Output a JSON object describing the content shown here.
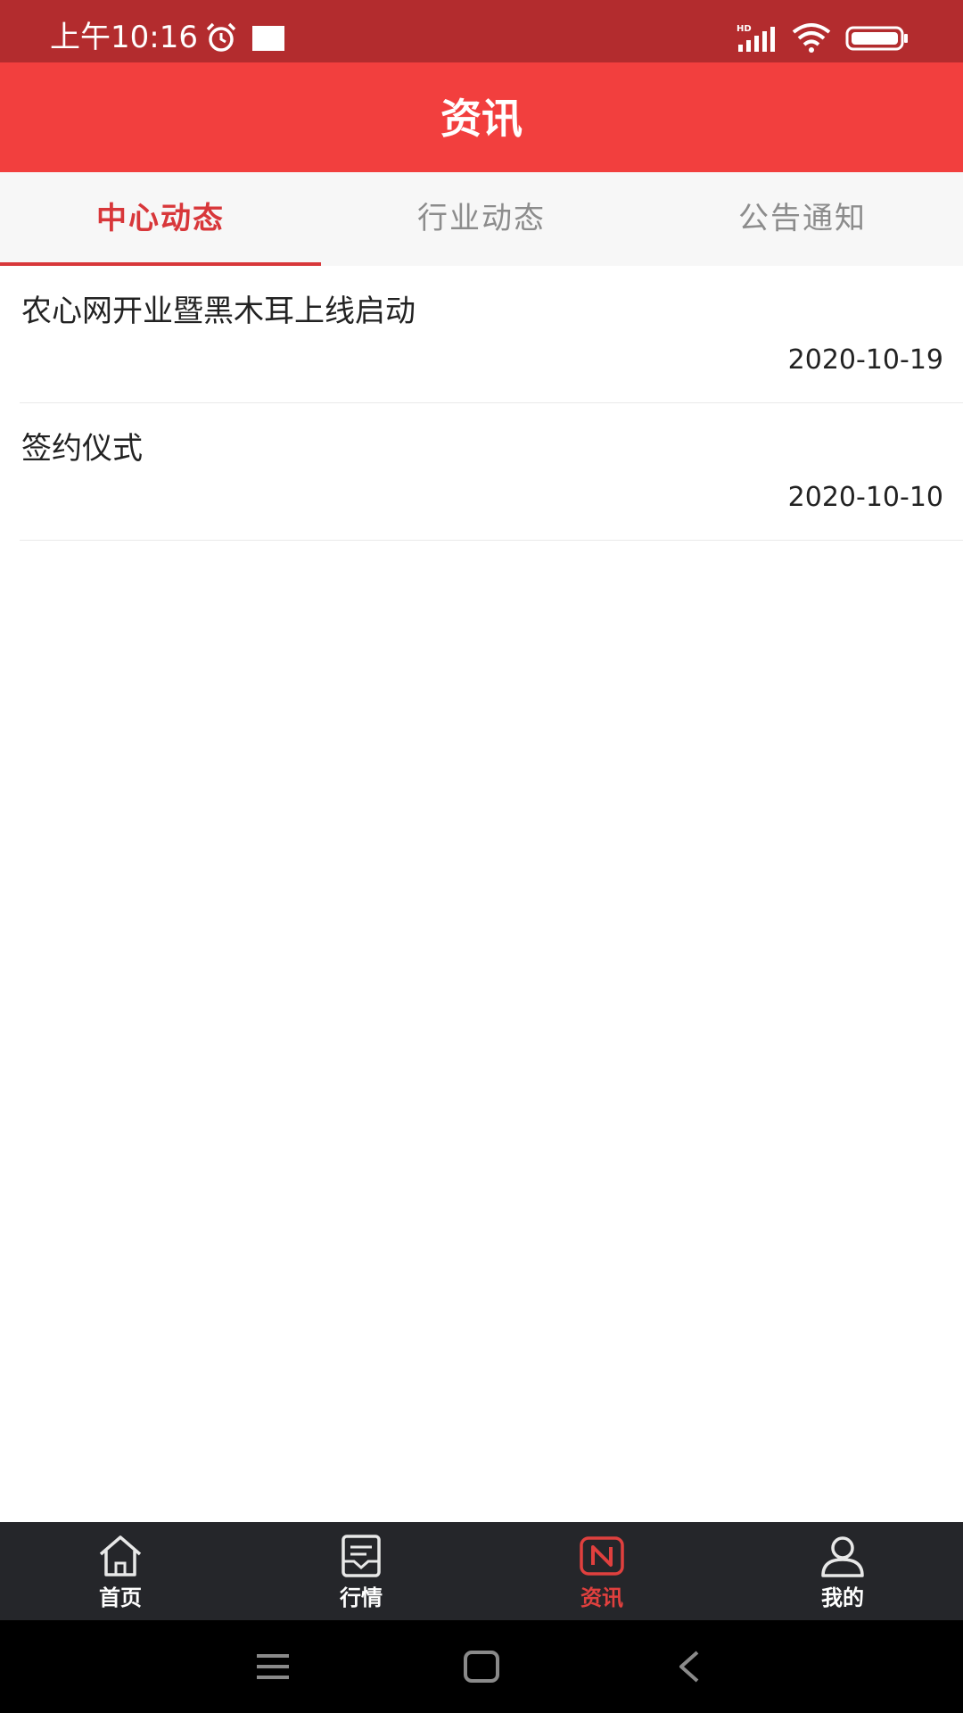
{
  "status_bar": {
    "time": "上午10:16",
    "icons": [
      "alarm-icon",
      "notification-icon",
      "signal-hd-icon",
      "wifi-icon",
      "battery-icon"
    ]
  },
  "header": {
    "title": "资讯"
  },
  "tabs": [
    {
      "label": "中心动态",
      "active": true
    },
    {
      "label": "行业动态",
      "active": false
    },
    {
      "label": "公告通知",
      "active": false
    }
  ],
  "news": [
    {
      "title": "农心网开业暨黑木耳上线启动",
      "date": "2020-10-19"
    },
    {
      "title": "签约仪式",
      "date": "2020-10-10"
    }
  ],
  "bottom_nav": [
    {
      "label": "首页",
      "icon": "home-icon",
      "active": false
    },
    {
      "label": "行情",
      "icon": "market-icon",
      "active": false
    },
    {
      "label": "资讯",
      "icon": "news-icon",
      "active": true
    },
    {
      "label": "我的",
      "icon": "profile-icon",
      "active": false
    }
  ],
  "system_nav": [
    "menu-icon",
    "home-square-icon",
    "back-icon"
  ],
  "colors": {
    "status_bar": "#b32c2e",
    "header": "#f23f3e",
    "accent": "#d8373a",
    "bottom_nav_bg": "#25262a"
  }
}
